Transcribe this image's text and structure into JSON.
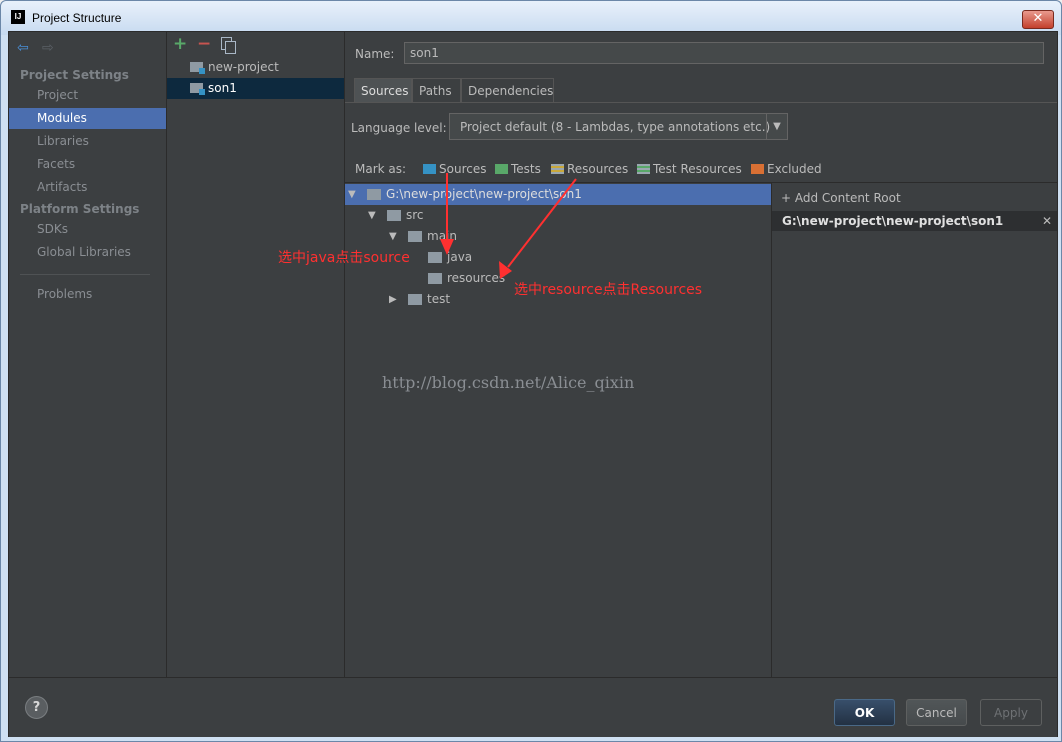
{
  "window": {
    "title": "Project Structure",
    "app_icon": "IJ"
  },
  "sidebar": {
    "sections": [
      {
        "heading": "Project Settings",
        "items": [
          "Project",
          "Modules",
          "Libraries",
          "Facets",
          "Artifacts"
        ]
      },
      {
        "heading": "Platform Settings",
        "items": [
          "SDKs",
          "Global Libraries"
        ]
      }
    ],
    "extra_item": "Problems",
    "selected": "Modules"
  },
  "modules": {
    "items": [
      "new-project",
      "son1"
    ],
    "selected": "son1"
  },
  "module": {
    "name_label": "Name:",
    "name_value": "son1",
    "tabs": [
      "Sources",
      "Paths",
      "Dependencies"
    ],
    "selected_tab": "Sources",
    "language_level_label": "Language level:",
    "language_level_value": "Project default (8 - Lambdas, type annotations etc.)",
    "mark_as_label": "Mark as:",
    "mark_as": [
      {
        "label": "Sources",
        "color": "#3592c4"
      },
      {
        "label": "Tests",
        "color": "#59a869"
      },
      {
        "label": "Resources",
        "color": "#9aa7b0"
      },
      {
        "label": "Test Resources",
        "color": "#9aa7b0"
      },
      {
        "label": "Excluded",
        "color": "#d97034"
      }
    ]
  },
  "tree": {
    "root": "G:\\new-project\\new-project\\son1",
    "src": "src",
    "main": "main",
    "java": "java",
    "resources": "resources",
    "test": "test"
  },
  "content_roots": {
    "add_label": "+ Add Content Root",
    "root_path": "G:\\new-project\\new-project\\son1"
  },
  "annotations": {
    "java_note": "选中java点击source",
    "resources_note": "选中resource点击Resources",
    "watermark": "http://blog.csdn.net/Alice_qixin",
    "arrow_color": "#ff3030"
  },
  "footer": {
    "help": "?",
    "ok": "OK",
    "cancel": "Cancel",
    "apply": "Apply"
  }
}
